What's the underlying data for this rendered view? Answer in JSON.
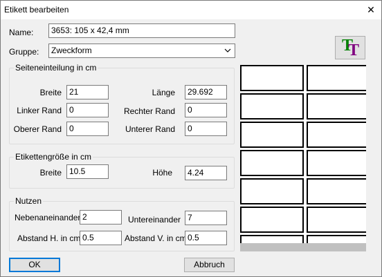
{
  "window": {
    "title": "Etikett bearbeiten",
    "close_glyph": "✕"
  },
  "name": {
    "label": "Name:",
    "value": "3653: 105 x 42,4 mm"
  },
  "gruppe": {
    "label": "Gruppe:",
    "value": "Zweckform",
    "options": [
      "Zweckform"
    ]
  },
  "seiteneinteilung": {
    "legend": "Seiteneinteilung in cm",
    "breite": {
      "label": "Breite",
      "value": "21"
    },
    "laenge": {
      "label": "Länge",
      "value": "29.692"
    },
    "linker_rand": {
      "label": "Linker Rand",
      "value": "0"
    },
    "rechter_rand": {
      "label": "Rechter Rand",
      "value": "0"
    },
    "oberer_rand": {
      "label": "Oberer Rand",
      "value": "0"
    },
    "unterer_rand": {
      "label": "Unterer Rand",
      "value": "0"
    }
  },
  "etikettengroesse": {
    "legend": "Etikettengröße in cm",
    "breite": {
      "label": "Breite",
      "value": "10.5"
    },
    "hoehe": {
      "label": "Höhe",
      "value": "4.24"
    }
  },
  "nutzen": {
    "legend": "Nutzen",
    "nebeneinander": {
      "label": "Nebenaneinander",
      "value": "2"
    },
    "untereinander": {
      "label": "Untereinander",
      "value": "7"
    },
    "abstand_h": {
      "label": "Abstand H. in cm",
      "value": "0.5"
    },
    "abstand_v": {
      "label": "Abstand V. in cm",
      "value": "0.5"
    }
  },
  "buttons": {
    "ok": "OK",
    "abbruch": "Abbruch"
  },
  "font_button": {
    "icon": "font-tt-icon",
    "glyph_1": "T",
    "glyph_2": "T",
    "color_1": "#008000",
    "color_2": "#800080"
  },
  "preview": {
    "columns": 2,
    "rows_visible": 7
  }
}
